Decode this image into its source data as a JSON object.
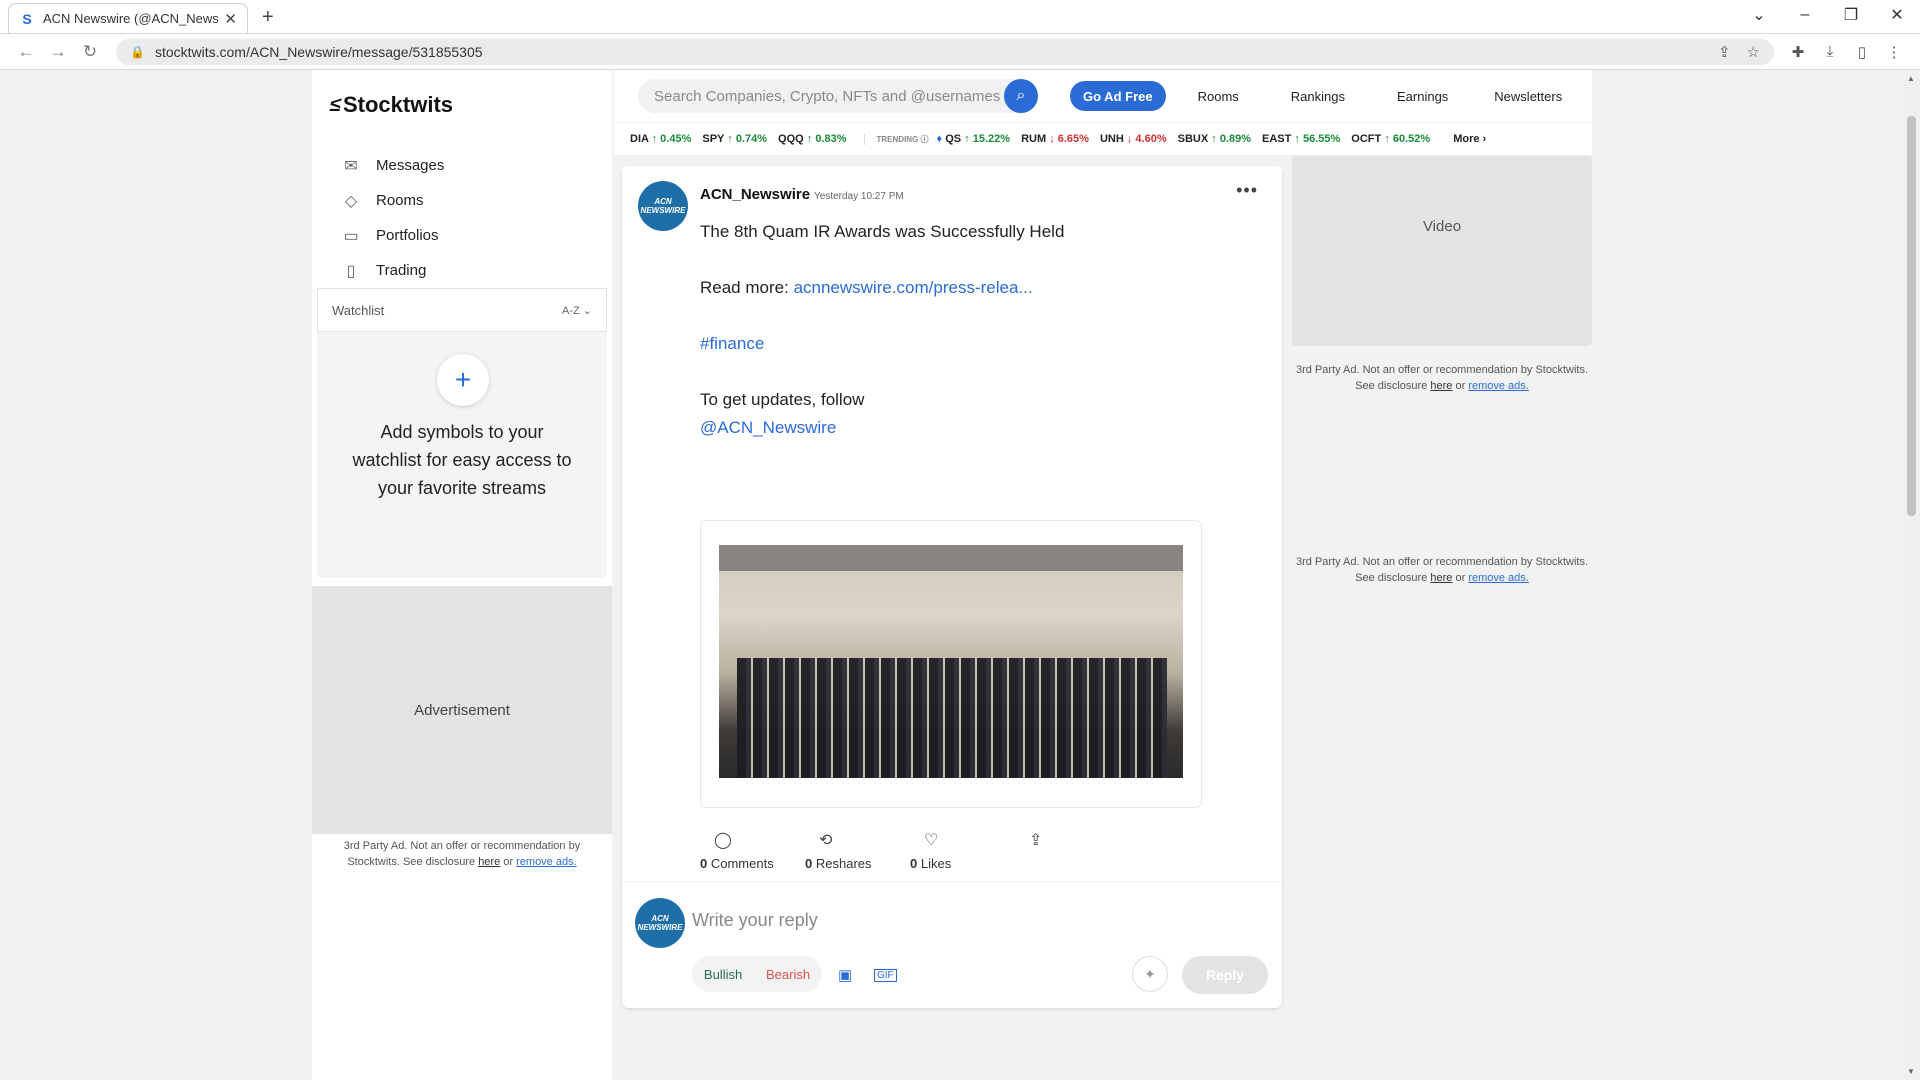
{
  "browser": {
    "tab_title": "ACN Newswire (@ACN_Newswire",
    "tab_favicon": "S",
    "url": "stocktwits.com/ACN_Newswire/message/531855305"
  },
  "logo": "Stocktwits",
  "nav": [
    {
      "label": "Messages",
      "icon": "envelope-icon"
    },
    {
      "label": "Rooms",
      "icon": "rooms-icon"
    },
    {
      "label": "Portfolios",
      "icon": "portfolio-icon"
    },
    {
      "label": "Trading",
      "icon": "trading-icon"
    }
  ],
  "watchlist": {
    "title": "Watchlist",
    "sort": "A-Z",
    "empty_message": "Add symbols to your watchlist for easy access to your favorite streams"
  },
  "ads": {
    "left_label": "Advertisement",
    "video_label": "Video",
    "disc_left_text": "3rd Party Ad. Not an offer or recommendation by Stocktwits. See disclosure",
    "disc_here": "here",
    "disc_or": "or",
    "disc_remove": "remove ads."
  },
  "header": {
    "search_placeholder": "Search Companies, Crypto, NFTs and @usernames",
    "go_ad_free": "Go Ad Free",
    "links": [
      "Rooms",
      "Rankings",
      "Earnings",
      "Newsletters"
    ]
  },
  "ticker": {
    "items": [
      {
        "sym": "DIA",
        "dir": "up",
        "chg": "0.45%"
      },
      {
        "sym": "SPY",
        "dir": "up",
        "chg": "0.74%"
      },
      {
        "sym": "QQQ",
        "dir": "up",
        "chg": "0.83%"
      }
    ],
    "trending_label": "TRENDING",
    "trending": [
      {
        "sym": "QS",
        "dir": "up",
        "chg": "15.22%"
      },
      {
        "sym": "RUM",
        "dir": "down",
        "chg": "6.65%"
      },
      {
        "sym": "UNH",
        "dir": "down",
        "chg": "4.60%"
      },
      {
        "sym": "SBUX",
        "dir": "up",
        "chg": "0.89%"
      },
      {
        "sym": "EAST",
        "dir": "up",
        "chg": "56.55%"
      },
      {
        "sym": "OCFT",
        "dir": "up",
        "chg": "60.52%"
      }
    ],
    "more": "More"
  },
  "post": {
    "avatar_text": "ACN NEWSWIRE",
    "username": "ACN_Newswire",
    "timestamp": "Yesterday 10:27 PM",
    "headline": "The 8th Quam IR Awards was Successfully Held",
    "read_more_label": "Read more:",
    "read_more_link": "acnnewswire.com/press-relea...",
    "hashtag": "#finance",
    "follow_text": "To get updates, follow",
    "follow_handle": "@ACN_Newswire",
    "comments_count": "0",
    "comments_label": "Comments",
    "reshares_count": "0",
    "reshares_label": "Reshares",
    "likes_count": "0",
    "likes_label": "Likes"
  },
  "reply": {
    "placeholder": "Write your reply",
    "bullish": "Bullish",
    "bearish": "Bearish",
    "button": "Reply"
  },
  "colors": {
    "brand_blue": "#2b6bd6",
    "up_green": "#1a8a3a",
    "down_red": "#d32f2f"
  }
}
